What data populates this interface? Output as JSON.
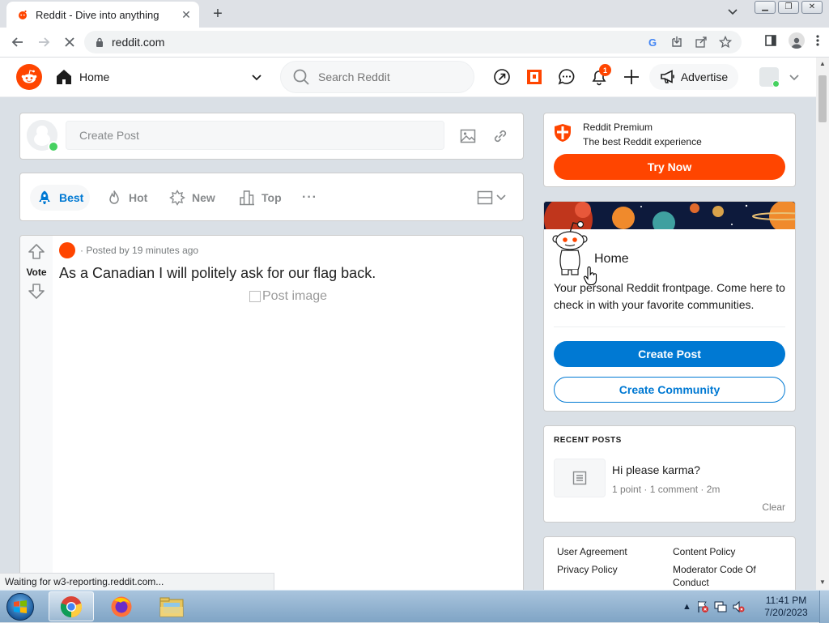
{
  "browser": {
    "tab_title": "Reddit - Dive into anything",
    "url": "reddit.com",
    "status_text": "Waiting for w3-reporting.reddit.com..."
  },
  "header": {
    "home_label": "Home",
    "search_placeholder": "Search Reddit",
    "notification_count": "1",
    "advertise_label": "Advertise"
  },
  "create_post": {
    "placeholder": "Create Post"
  },
  "sort": {
    "items": [
      {
        "label": "Best",
        "icon": "rocket-icon",
        "active": true
      },
      {
        "label": "Hot",
        "icon": "flame-icon"
      },
      {
        "label": "New",
        "icon": "sparkle-icon"
      },
      {
        "label": "Top",
        "icon": "bar-chart-icon"
      }
    ],
    "more_label": "···"
  },
  "post": {
    "vote_label": "Vote",
    "meta": "· Posted by 19 minutes ago",
    "title": "As a Canadian I will politely ask for our flag back.",
    "image_alt": "Post image"
  },
  "premium": {
    "title": "Reddit Premium",
    "subtitle": "The best Reddit experience",
    "button": "Try Now"
  },
  "home_card": {
    "title": "Home",
    "description": "Your personal Reddit frontpage. Come here to check in with your favorite communities.",
    "create_post_button": "Create Post",
    "create_community_button": "Create Community"
  },
  "recent_posts": {
    "heading": "RECENT POSTS",
    "items": [
      {
        "title": "Hi please karma?",
        "meta": "1 point · 1 comment · 2m"
      }
    ],
    "clear_label": "Clear"
  },
  "footer_links": {
    "col1": [
      "User Agreement",
      "Privacy Policy"
    ],
    "col2": [
      "Content Policy",
      "Moderator Code Of Conduct"
    ]
  },
  "taskbar": {
    "time": "11:41 PM",
    "date": "7/20/2023"
  },
  "colors": {
    "reddit_orange": "#ff4500",
    "reddit_blue": "#0079d3",
    "page_bg": "#dae0e6"
  }
}
